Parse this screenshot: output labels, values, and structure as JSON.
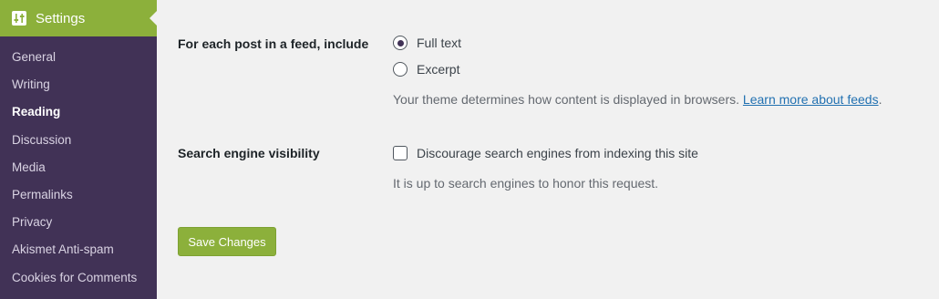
{
  "sidebar": {
    "header": {
      "label": "Settings",
      "icon": "settings-sliders-icon"
    },
    "items": [
      {
        "label": "General"
      },
      {
        "label": "Writing"
      },
      {
        "label": "Reading",
        "active": true
      },
      {
        "label": "Discussion"
      },
      {
        "label": "Media"
      },
      {
        "label": "Permalinks"
      },
      {
        "label": "Privacy"
      },
      {
        "label": "Akismet Anti-spam"
      },
      {
        "label": "Cookies for Comments"
      }
    ]
  },
  "feed": {
    "label": "For each post in a feed, include",
    "options": [
      {
        "label": "Full text",
        "checked": true
      },
      {
        "label": "Excerpt",
        "checked": false
      }
    ],
    "description": "Your theme determines how content is displayed in browsers.",
    "link_text": "Learn more about feeds",
    "link_suffix": "."
  },
  "search": {
    "label": "Search engine visibility",
    "checkbox_label": "Discourage search engines from indexing this site",
    "checked": false,
    "description": "It is up to search engines to honor this request."
  },
  "save_button": {
    "label": "Save Changes"
  },
  "colors": {
    "sidebar_bg": "#413256",
    "accent": "#8cb03b",
    "link": "#2271b1",
    "page_bg": "#f1f1f1"
  }
}
